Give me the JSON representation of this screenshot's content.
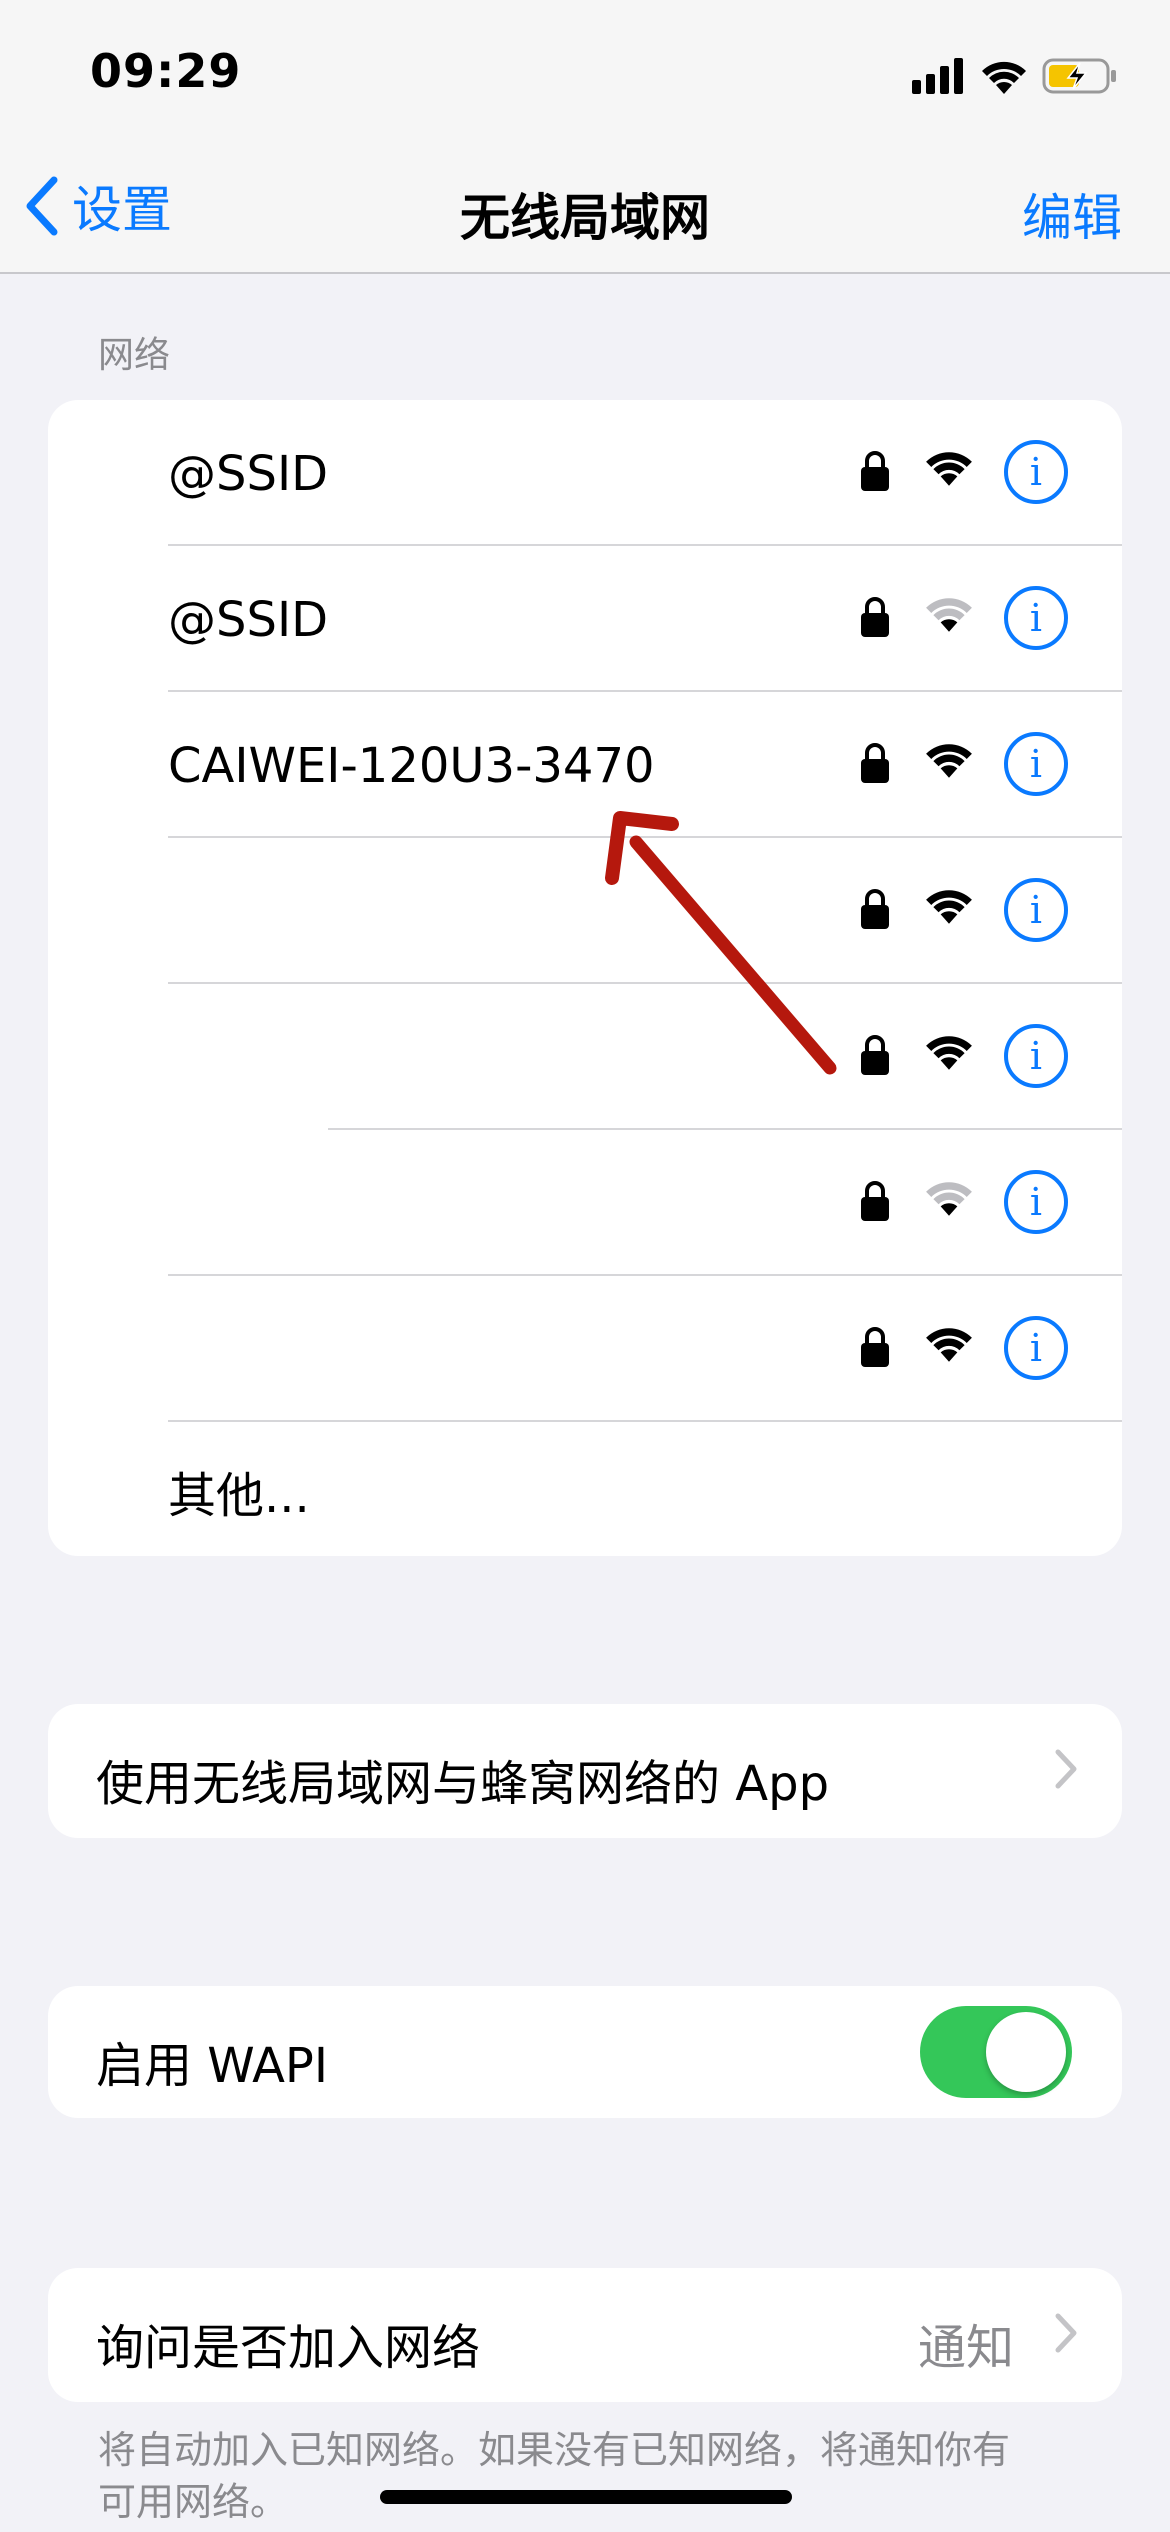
{
  "status_bar": {
    "time": "09:29",
    "battery_state": "charging"
  },
  "nav": {
    "back_label": "设置",
    "title": "无线局域网",
    "edit_label": "编辑"
  },
  "networks": {
    "header": "网络",
    "items": [
      {
        "name": "@SSID",
        "locked": true,
        "signal": "full"
      },
      {
        "name": "@SSID",
        "locked": true,
        "signal": "weak"
      },
      {
        "name": "CAIWEI-120U3-3470",
        "locked": true,
        "signal": "full"
      },
      {
        "name": "",
        "locked": true,
        "signal": "full"
      },
      {
        "name": "",
        "locked": true,
        "signal": "full"
      },
      {
        "name": "",
        "locked": true,
        "signal": "weak"
      },
      {
        "name": "",
        "locked": true,
        "signal": "full"
      }
    ],
    "other_label": "其他..."
  },
  "apps_row": {
    "label": "使用无线局域网与蜂窝网络的 App"
  },
  "wapi_row": {
    "label": "启用 WAPI",
    "enabled": true
  },
  "ask_row": {
    "label": "询问是否加入网络",
    "value": "通知"
  },
  "footnote": "将自动加入已知网络。如果没有已知网络，将通知你有可用网络。",
  "colors": {
    "accent": "#0a7aff",
    "toggle_on": "#34c759",
    "annotation_arrow": "#b5180d",
    "background": "#f2f2f7"
  }
}
